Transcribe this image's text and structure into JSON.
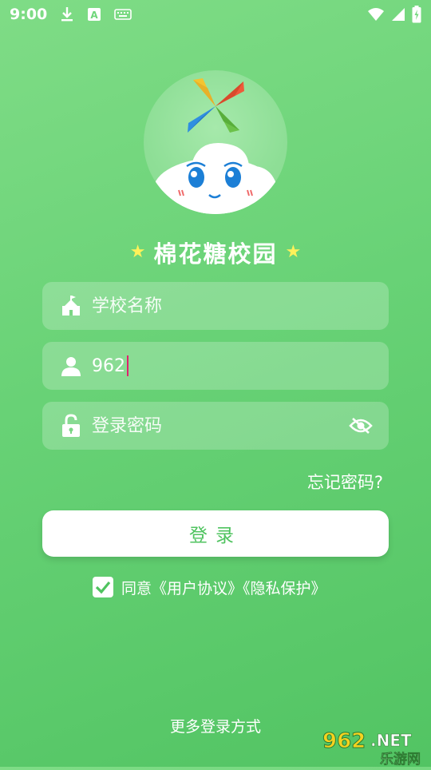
{
  "status_bar": {
    "time": "9:00",
    "icons": [
      "download-icon",
      "a-keyboard-icon",
      "keyboard-icon",
      "wifi-icon",
      "signal-icon",
      "battery-charging-icon"
    ]
  },
  "app": {
    "title": "棉花糖校园",
    "title_star_icon": "star-icon",
    "accent_color": "#4fc35f",
    "star_color": "#fff15a"
  },
  "form": {
    "school": {
      "placeholder": "学校名称",
      "icon": "school-icon"
    },
    "account": {
      "value": "962",
      "icon": "user-icon"
    },
    "password": {
      "placeholder": "登录密码",
      "icon": "lock-icon",
      "toggle_icon": "eye-off-icon"
    },
    "forgot_label": "忘记密码?",
    "login_label": "登录",
    "agree_text": "同意《用户协议》《隐私保护》",
    "agree_checked": true
  },
  "more_login_label": "更多登录方式",
  "watermark": {
    "text": "962.NET",
    "subtext": "乐游网"
  }
}
